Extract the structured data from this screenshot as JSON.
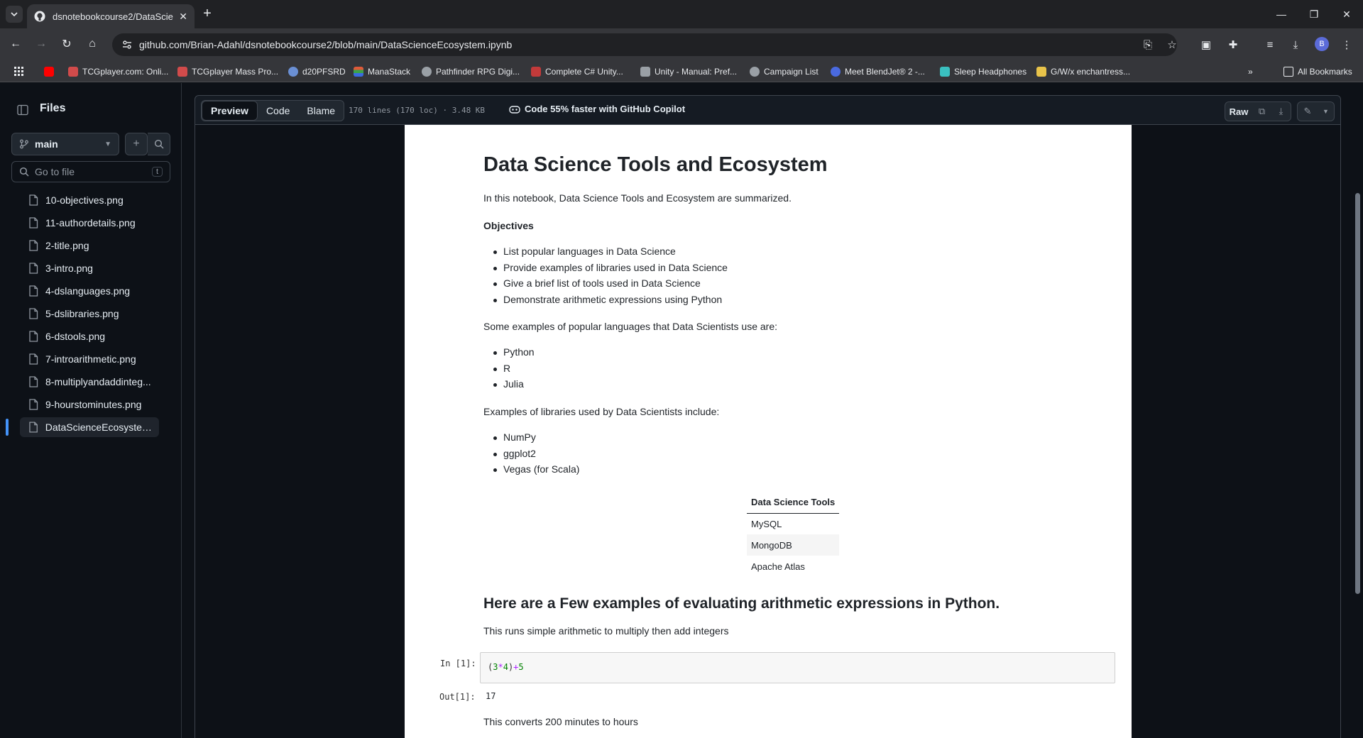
{
  "browser": {
    "tab_title": "dsnotebookcourse2/DataScienceEcosystem.ipynb",
    "url": "github.com/Brian-Adahl/dsnotebookcourse2/blob/main/DataScienceEcosystem.ipynb",
    "avatar_letter": "B",
    "bookmarks": [
      "TCGplayer.com: Onli...",
      "TCGplayer Mass Pro...",
      "d20PFSRD",
      "ManaStack",
      "Pathfinder RPG Digi...",
      "Complete C# Unity...",
      "Unity - Manual: Pref...",
      "Campaign List",
      "Meet BlendJet® 2 -...",
      "Sleep Headphones",
      "G/W/x enchantress..."
    ],
    "all_bookmarks": "All Bookmarks"
  },
  "sidebar": {
    "title": "Files",
    "branch": "main",
    "goto_placeholder": "Go to file",
    "goto_shortcut": "t",
    "files": [
      "10-objectives.png",
      "11-authordetails.png",
      "2-title.png",
      "3-intro.png",
      "4-dslanguages.png",
      "5-dslibraries.png",
      "6-dstools.png",
      "7-introarithmetic.png",
      "8-multiplyandaddinteg...",
      "9-hourstominutes.png",
      "DataScienceEcosystem...."
    ]
  },
  "file_header": {
    "tabs": [
      "Preview",
      "Code",
      "Blame"
    ],
    "meta": "170 lines (170 loc) · 3.48 KB",
    "copilot": "Code 55% faster with GitHub Copilot",
    "raw": "Raw"
  },
  "notebook": {
    "title": "Data Science Tools and Ecosystem",
    "intro": "In this notebook, Data Science Tools and Ecosystem are summarized.",
    "objectives_heading": "Objectives",
    "objectives": [
      "List popular languages in Data Science",
      "Provide examples of libraries used in Data Science",
      "Give a brief list of tools used in Data Science",
      "Demonstrate arithmetic expressions using Python"
    ],
    "languages_intro": "Some examples of popular languages that Data Scientists use are:",
    "languages": [
      "Python",
      "R",
      "Julia"
    ],
    "libraries_intro": "Examples of libraries used by Data Scientists include:",
    "libraries": [
      "NumPy",
      "ggplot2",
      "Vegas (for Scala)"
    ],
    "tools_header": "Data Science Tools",
    "tools": [
      "MySQL",
      "MongoDB",
      "Apache Atlas"
    ],
    "arith_heading": "Here are a Few examples of evaluating arithmetic expressions in Python.",
    "arith_desc": "This runs simple arithmetic to multiply then add integers",
    "in_prompt": "In [1]:",
    "code": {
      "open": "(",
      "a": "3",
      "op1": "*",
      "b": "4",
      "close": ")",
      "op2": "+",
      "c": "5"
    },
    "out_prompt": "Out[1]:",
    "output": "17",
    "convert_desc": "This converts 200 minutes to hours"
  }
}
